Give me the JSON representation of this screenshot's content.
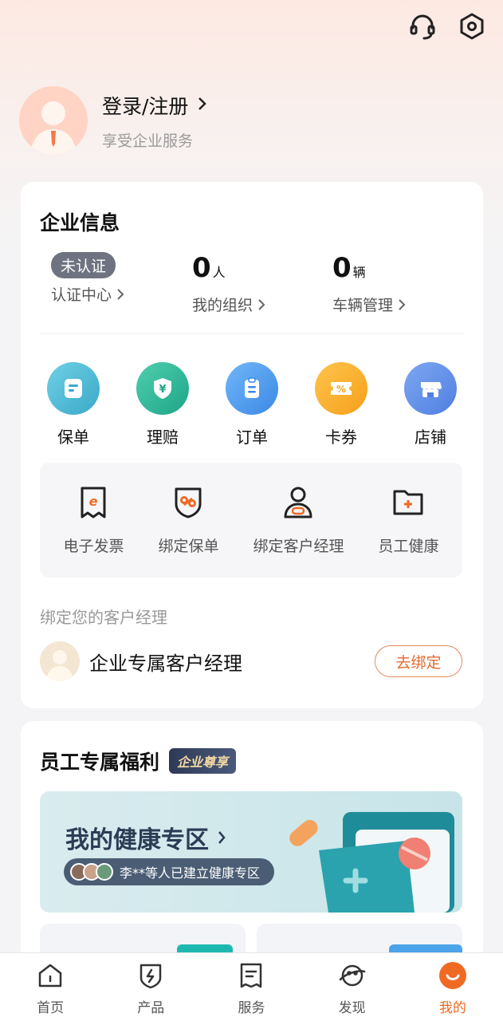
{
  "profile": {
    "login_label": "登录/注册",
    "subtitle": "享受企业服务"
  },
  "enterprise": {
    "title": "企业信息",
    "cert_badge": "未认证",
    "cert_label": "认证中心",
    "org_count": "0",
    "org_unit": "人",
    "org_label": "我的组织",
    "vehicle_count": "0",
    "vehicle_unit": "辆",
    "vehicle_label": "车辆管理",
    "quick": [
      {
        "label": "保单",
        "icon": "policy-icon",
        "color": "#4cbcd6"
      },
      {
        "label": "理赔",
        "icon": "claim-icon",
        "color": "#2fb39a"
      },
      {
        "label": "订单",
        "icon": "order-icon",
        "color": "#4e9ff0"
      },
      {
        "label": "卡券",
        "icon": "coupon-icon",
        "color": "#f5a623"
      },
      {
        "label": "店铺",
        "icon": "store-icon",
        "color": "#5b8de8"
      }
    ],
    "tools": [
      {
        "label": "电子发票",
        "icon": "invoice-icon"
      },
      {
        "label": "绑定保单",
        "icon": "bind-policy-icon"
      },
      {
        "label": "绑定客户经理",
        "icon": "bind-manager-icon"
      },
      {
        "label": "员工健康",
        "icon": "health-folder-icon"
      }
    ],
    "bind_title": "绑定您的客户经理",
    "manager_name": "企业专属客户经理",
    "bind_button": "去绑定"
  },
  "benefits": {
    "title": "员工专属福利",
    "badge": "企业尊享",
    "banner_title": "我的健康专区",
    "banner_pill": "李**等人已建立健康专区"
  },
  "tabbar": [
    {
      "label": "首页",
      "icon": "home-icon"
    },
    {
      "label": "产品",
      "icon": "product-icon"
    },
    {
      "label": "服务",
      "icon": "service-icon"
    },
    {
      "label": "发现",
      "icon": "discover-icon"
    },
    {
      "label": "我的",
      "icon": "mine-icon"
    }
  ],
  "colors": {
    "accent": "#f06a24",
    "badge_gray": "#6f7381"
  }
}
